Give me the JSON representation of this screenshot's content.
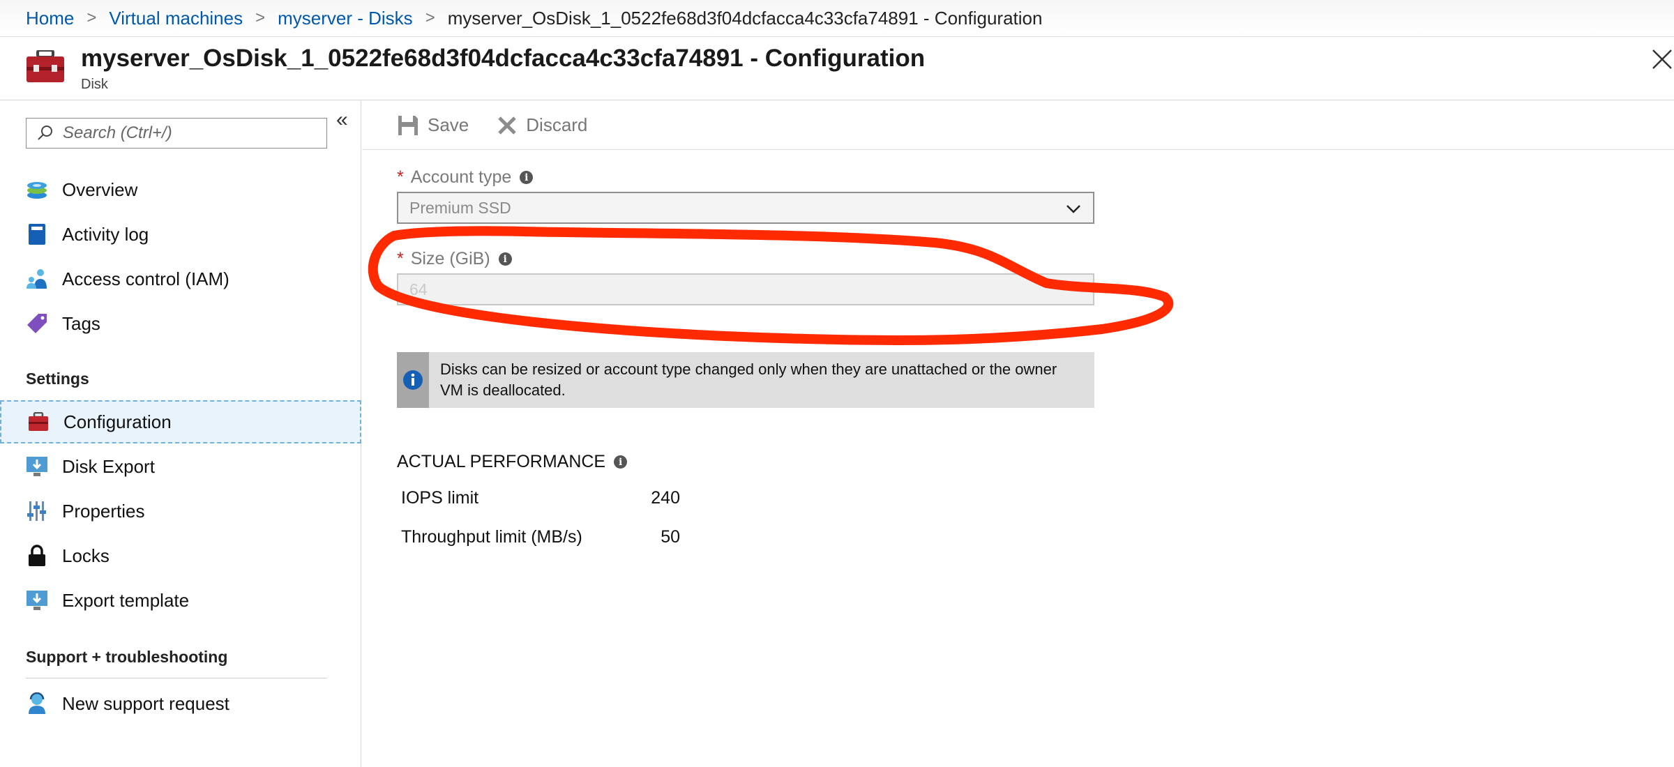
{
  "breadcrumb": {
    "items": [
      "Home",
      "Virtual machines",
      "myserver - Disks"
    ],
    "current": "myserver_OsDisk_1_0522fe68d3f04dcfacca4c33cfa74891 - Configuration",
    "separator": ">"
  },
  "header": {
    "title": "myserver_OsDisk_1_0522fe68d3f04dcfacca4c33cfa74891 - Configuration",
    "subtitle": "Disk",
    "icon": "disk-toolbox-icon"
  },
  "sidebar": {
    "search_placeholder": "Search (Ctrl+/)",
    "collapse_glyph": "«",
    "items": [
      {
        "label": "Overview",
        "icon": "overview-icon"
      },
      {
        "label": "Activity log",
        "icon": "activity-log-icon"
      },
      {
        "label": "Access control (IAM)",
        "icon": "iam-icon"
      },
      {
        "label": "Tags",
        "icon": "tag-icon"
      }
    ],
    "sections": [
      {
        "title": "Settings",
        "items": [
          {
            "label": "Configuration",
            "icon": "toolbox-icon",
            "active": true
          },
          {
            "label": "Disk Export",
            "icon": "export-icon"
          },
          {
            "label": "Properties",
            "icon": "properties-icon"
          },
          {
            "label": "Locks",
            "icon": "lock-icon"
          },
          {
            "label": "Export template",
            "icon": "export-template-icon"
          }
        ]
      },
      {
        "title": "Support + troubleshooting",
        "items": [
          {
            "label": "New support request",
            "icon": "support-icon"
          }
        ]
      }
    ]
  },
  "toolbar": {
    "save_label": "Save",
    "discard_label": "Discard"
  },
  "form": {
    "account_type": {
      "label": "Account type",
      "required_marker": "*",
      "value": "Premium SSD"
    },
    "size": {
      "label": "Size (GiB)",
      "required_marker": "*",
      "value": "64"
    }
  },
  "notice": {
    "text": "Disks can be resized or account type changed only when they are unattached or the owner VM is deallocated."
  },
  "performance": {
    "heading": "ACTUAL PERFORMANCE",
    "rows": [
      {
        "label": "IOPS limit",
        "value": "240"
      },
      {
        "label": "Throughput limit (MB/s)",
        "value": "50"
      }
    ]
  },
  "colors": {
    "link": "#0058ad",
    "required": "#cc2222",
    "annotation": "#ff2a00",
    "active_bg": "#e8f3fb"
  }
}
